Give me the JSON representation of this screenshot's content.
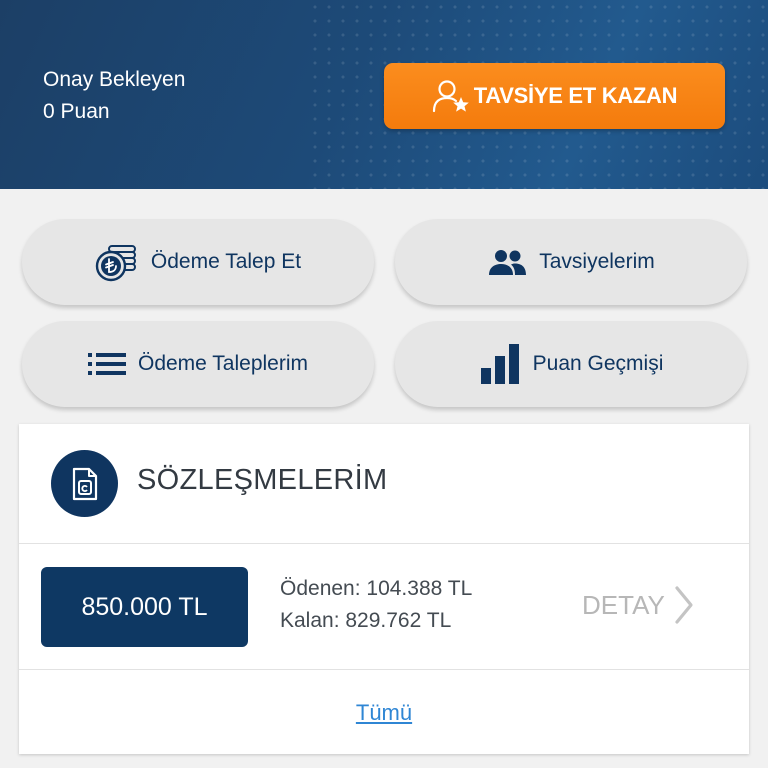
{
  "header": {
    "pending_label": "Onay Bekleyen",
    "pending_points": "0 Puan",
    "refer_button_label": "TAVSİYE ET KAZAN"
  },
  "actions": [
    {
      "label": "Ödeme Talep Et",
      "icon": "coin-stack-icon"
    },
    {
      "label": "Tavsiyelerim",
      "icon": "users-icon"
    },
    {
      "label": "Ödeme Taleplerim",
      "icon": "list-icon"
    },
    {
      "label": "Puan Geçmişi",
      "icon": "bar-chart-icon"
    }
  ],
  "contracts": {
    "title": "SÖZLEŞMELERİM",
    "icon": "document-icon",
    "items": [
      {
        "amount": "850.000 TL",
        "paid": "Ödenen: 104.388 TL",
        "remaining": "Kalan: 829.762 TL",
        "detail_label": "DETAY"
      }
    ],
    "all_label": "Tümü"
  },
  "colors": {
    "primary": "#0f3560",
    "accent": "#f47b0c",
    "link": "#2f86d4"
  }
}
